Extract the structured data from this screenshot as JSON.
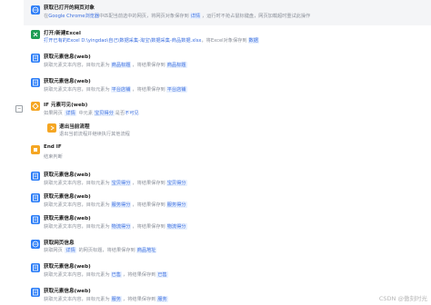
{
  "rows": [
    {
      "title": "获取已打开的网页对象",
      "parts": [
        {
          "t": "在"
        },
        {
          "t": "Google Chrome浏览器",
          "c": "blue"
        },
        {
          "t": "中匹配当前选中的网页，将网页对象保存到"
        },
        {
          "t": "详情",
          "c": "chip"
        },
        {
          "t": "，运行时不抢占鼠标键盘，网页加载超时重试此操作"
        }
      ],
      "icon": "globe",
      "color": "#2d7ef7",
      "selected": true
    },
    {
      "title": "打开/新建Excel",
      "parts": [
        {
          "t": "打开已有的Excel D:\\yingdao\\自己\\数据采集-淘宝\\数据采集-商品数据.xlsx",
          "c": "blue"
        },
        {
          "t": "，将Excel对象保存到"
        },
        {
          "t": "数据",
          "c": "chip"
        }
      ],
      "icon": "excel",
      "color": "#1f9d55"
    },
    {
      "title": "获取元素信息(web)",
      "parts": [
        {
          "t": "获取元素文本内容，目标元素为"
        },
        {
          "t": "商品标题",
          "c": "chip"
        },
        {
          "t": "，将结果保存到"
        },
        {
          "t": "商品标题",
          "c": "chip"
        }
      ],
      "icon": "doc",
      "color": "#2d7ef7"
    },
    {
      "title": "获取元素信息(web)",
      "parts": [
        {
          "t": "获取元素文本内容，目标元素为"
        },
        {
          "t": "平台店铺",
          "c": "chip"
        },
        {
          "t": "，将结果保存到"
        },
        {
          "t": "平台店铺",
          "c": "chip"
        }
      ],
      "icon": "doc",
      "color": "#2d7ef7"
    },
    {
      "title": "IF 元素可见(web)",
      "parts": [
        {
          "t": "如果网页 "
        },
        {
          "t": "详情",
          "c": "chip"
        },
        {
          "t": " 中元素"
        },
        {
          "t": "宝贝得分",
          "c": "chip"
        },
        {
          "t": "是否"
        },
        {
          "t": "不可见",
          "c": "blue"
        }
      ],
      "icon": "if",
      "color": "#f5a623"
    },
    {
      "title": "退出当前流程",
      "parts": [
        {
          "t": "退出当前流程并继续执行其他流程"
        }
      ],
      "icon": "exit",
      "color": "#f5a623"
    },
    {
      "title": "End IF",
      "parts": [
        {
          "t": "结束判断"
        }
      ],
      "icon": "end",
      "color": "#f5a623"
    },
    {
      "title": "获取元素信息(web)",
      "parts": [
        {
          "t": "获取元素文本内容，目标元素为"
        },
        {
          "t": "宝贝得分",
          "c": "chip"
        },
        {
          "t": "，将结果保存到"
        },
        {
          "t": "宝贝得分",
          "c": "chip"
        }
      ],
      "icon": "doc",
      "color": "#2d7ef7"
    },
    {
      "title": "获取元素信息(web)",
      "parts": [
        {
          "t": "获取元素文本内容，目标元素为"
        },
        {
          "t": "服务得分",
          "c": "chip"
        },
        {
          "t": "，将结果保存到"
        },
        {
          "t": "服务得分",
          "c": "chip"
        }
      ],
      "icon": "doc",
      "color": "#2d7ef7"
    },
    {
      "title": "获取元素信息(web)",
      "parts": [
        {
          "t": "获取元素文本内容，目标元素为"
        },
        {
          "t": "物流得分",
          "c": "chip"
        },
        {
          "t": "，将结果保存到"
        },
        {
          "t": "物流得分",
          "c": "chip"
        }
      ],
      "icon": "doc",
      "color": "#2d7ef7"
    },
    {
      "title": "获取网页信息",
      "parts": [
        {
          "t": "获取网页 "
        },
        {
          "t": "详情",
          "c": "chip"
        },
        {
          "t": " 的网页标题，将结果保存到"
        },
        {
          "t": "商品地址",
          "c": "chip"
        }
      ],
      "icon": "globe",
      "color": "#2d7ef7"
    },
    {
      "title": "获取元素信息(web)",
      "parts": [
        {
          "t": "获取元素文本内容，目标元素为"
        },
        {
          "t": "已售",
          "c": "chip"
        },
        {
          "t": "，将结果保存到"
        },
        {
          "t": "已售",
          "c": "chip"
        }
      ],
      "icon": "doc",
      "color": "#2d7ef7"
    },
    {
      "title": "获取元素信息(web)",
      "parts": [
        {
          "t": "获取元素文本内容，目标元素为"
        },
        {
          "t": "服务",
          "c": "chip"
        },
        {
          "t": "，将结果保存到"
        },
        {
          "t": "服务",
          "c": "chip"
        }
      ],
      "icon": "doc",
      "color": "#2d7ef7"
    }
  ],
  "watermark": "CSDN @傲刻时光",
  "gutter": {
    "toggle": "−"
  }
}
